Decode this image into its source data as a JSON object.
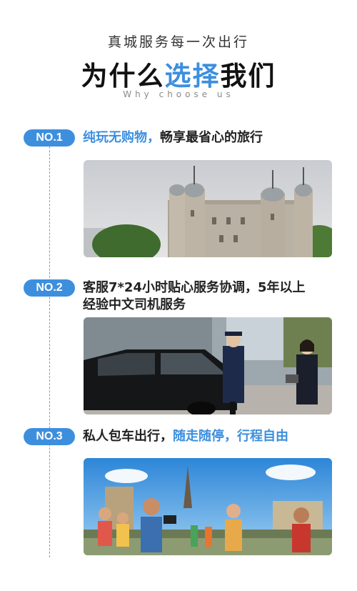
{
  "header": {
    "subtitle": "真城服务每一次出行",
    "title_part1": "为什么",
    "title_highlight": "选择",
    "title_part2": "我们",
    "subtitle_en": "Why choose us"
  },
  "items": [
    {
      "badge": "NO.1",
      "text_highlight": "纯玩无购物，",
      "text_rest": "畅享最省心的旅行",
      "image": "tower-of-london-photo"
    },
    {
      "badge": "NO.2",
      "line1": "客服7*24小时贴心服务协调，5年以上",
      "line2": "经验中文司机服务",
      "image": "chauffeur-car-photo"
    },
    {
      "badge": "NO.3",
      "text_start": "私人包车出行，",
      "text_highlight": "随走随停，行程自由",
      "image": "tourists-selfie-photo"
    }
  ],
  "colors": {
    "accent": "#3d8fde",
    "text": "#222222"
  }
}
